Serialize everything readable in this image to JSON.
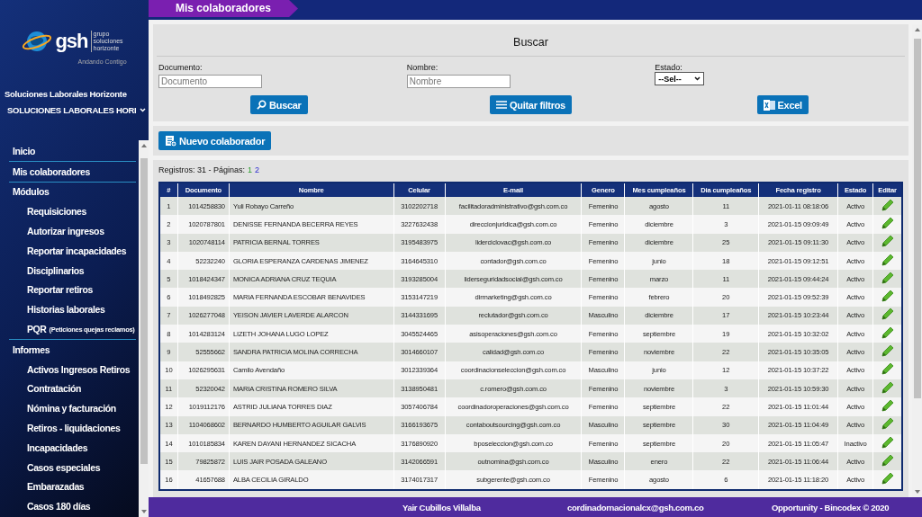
{
  "logo": {
    "name": "gsh",
    "tagline": "grupo soluciones horizonte",
    "motto": "Andando Contigo"
  },
  "company": {
    "title": "Soluciones Laborales Horizonte",
    "selector": "SOLUCIONES LABORALES HORI"
  },
  "menu": [
    {
      "label": "Inicio"
    },
    {
      "label": "Mis colaboradores"
    },
    {
      "label": "Módulos",
      "children": [
        {
          "label": "Requisiciones"
        },
        {
          "label": "Autorizar ingresos"
        },
        {
          "label": "Reportar incapacidades"
        },
        {
          "label": "Disciplinarios"
        },
        {
          "label": "Reportar retiros"
        },
        {
          "label": "Historias laborales"
        },
        {
          "label": "PQR",
          "note": "(Peticiones quejas reclamos)"
        }
      ]
    },
    {
      "label": "Informes",
      "children": [
        {
          "label": "Activos Ingresos Retiros"
        },
        {
          "label": "Contratación"
        },
        {
          "label": "Nómina y facturación"
        },
        {
          "label": "Retiros - liquidaciones"
        },
        {
          "label": "Incapacidades"
        },
        {
          "label": "Casos especiales"
        },
        {
          "label": "Embarazadas"
        },
        {
          "label": "Casos 180 días"
        }
      ]
    }
  ],
  "page_tab": "Mis colaboradores",
  "search": {
    "title": "Buscar",
    "fields": [
      {
        "label": "Documento:",
        "placeholder": "Documento",
        "kind": "text"
      },
      {
        "label": "Nombre:",
        "placeholder": "Nombre",
        "kind": "text"
      },
      {
        "label": "Estado:",
        "value": "--Sel--",
        "kind": "select"
      }
    ],
    "buttons": [
      {
        "label": "Buscar",
        "kind": "search"
      },
      {
        "label": "Quitar filtros",
        "kind": "clear"
      },
      {
        "label": "Excel",
        "kind": "export"
      }
    ]
  },
  "new_button": "Nuevo colaborador",
  "summary": "Registros: 31 - Páginas:",
  "pages": [
    {
      "label": "1",
      "selected": true
    },
    {
      "label": "2",
      "selected": false
    }
  ],
  "table": {
    "columns": [
      "#",
      "Documento",
      "Nombre",
      "Celular",
      "E-mail",
      "Genero",
      "Mes cumpleaños",
      "Dia cumpleaños",
      "Fecha registro",
      "Estado",
      "Editar"
    ],
    "rows": [
      [
        "1",
        "1014258830",
        "Yuli Robayo Carreño",
        "3102202718",
        "facilitadoradministrativo@gsh.com.co",
        "Femenino",
        "agosto",
        "11",
        "2021-01-11 08:18:06",
        "Activo"
      ],
      [
        "2",
        "1020787801",
        "DENISSE FERNANDA BECERRA REYES",
        "3227632438",
        "direccionjuridica@gsh.com.co",
        "Femenino",
        "diciembre",
        "3",
        "2021-01-15 09:09:49",
        "Activo"
      ],
      [
        "3",
        "1020748114",
        "PATRICIA BERNAL TORRES",
        "3195483975",
        "liderciclovac@gsh.com.co",
        "Femenino",
        "diciembre",
        "25",
        "2021-01-15 09:11:30",
        "Activo"
      ],
      [
        "4",
        "52232240",
        "GLORIA ESPERANZA CARDENAS JIMENEZ",
        "3164645310",
        "contador@gsh.com.co",
        "Femenino",
        "junio",
        "18",
        "2021-01-15 09:12:51",
        "Activo"
      ],
      [
        "5",
        "1018424347",
        "MONICA ADRIANA CRUZ TEQUIA",
        "3193285004",
        "liderseguridadsocial@gsh.com.co",
        "Femenino",
        "marzo",
        "11",
        "2021-01-15 09:44:24",
        "Activo"
      ],
      [
        "6",
        "1018492825",
        "MARIA FERNANDA ESCOBAR BENAVIDES",
        "3153147219",
        "dirmarketing@gsh.com.co",
        "Femenino",
        "febrero",
        "20",
        "2021-01-15 09:52:39",
        "Activo"
      ],
      [
        "7",
        "1026277048",
        "YEISON JAVIER LAVERDE ALARCON",
        "3144331695",
        "reclutador@gsh.com.co",
        "Masculino",
        "diciembre",
        "17",
        "2021-01-15 10:23:44",
        "Activo"
      ],
      [
        "8",
        "1014283124",
        "LIZETH JOHANA LUGO LOPEZ",
        "3045524465",
        "asisoperaciones@gsh.com.co",
        "Femenino",
        "septiembre",
        "19",
        "2021-01-15 10:32:02",
        "Activo"
      ],
      [
        "9",
        "52555662",
        "SANDRA PATRICIA MOLINA CORRECHA",
        "3014660107",
        "calidad@gsh.com.co",
        "Femenino",
        "noviembre",
        "22",
        "2021-01-15 10:35:05",
        "Activo"
      ],
      [
        "10",
        "1026295631",
        "Camilo Avendaño",
        "3012339364",
        "coordinacionseleccion@gsh.com.co",
        "Masculino",
        "junio",
        "12",
        "2021-01-15 10:37:22",
        "Activo"
      ],
      [
        "11",
        "52320042",
        "MARIA CRISTINA ROMERO SILVA",
        "3138950481",
        "c.romero@gsh.com.co",
        "Femenino",
        "noviembre",
        "3",
        "2021-01-15 10:59:30",
        "Activo"
      ],
      [
        "12",
        "1019112176",
        "ASTRID JULIANA TORRES DIAZ",
        "3057406784",
        "coordinadoroperaciones@gsh.com.co",
        "Femenino",
        "septiembre",
        "22",
        "2021-01-15 11:01:44",
        "Activo"
      ],
      [
        "13",
        "1104068602",
        "BERNARDO HUMBERTO AGUILAR GALVIS",
        "3166193675",
        "contaboutsourcing@gsh.com.co",
        "Masculino",
        "septiembre",
        "30",
        "2021-01-15 11:04:49",
        "Activo"
      ],
      [
        "14",
        "1010185834",
        "KAREN DAYANI HERNANDEZ SICACHA",
        "3176890920",
        "bposeleccion@gsh.com.co",
        "Femenino",
        "septiembre",
        "20",
        "2021-01-15 11:05:47",
        "Inactivo"
      ],
      [
        "15",
        "79825872",
        "LUIS JAIR POSADA GALEANO",
        "3142066591",
        "outnomina@gsh.com.co",
        "Masculino",
        "enero",
        "22",
        "2021-01-15 11:06:44",
        "Activo"
      ],
      [
        "16",
        "41657688",
        "ALBA CECILIA GIRALDO",
        "3174017317",
        "subgerente@gsh.com.co",
        "Femenino",
        "agosto",
        "6",
        "2021-01-15 11:18:20",
        "Activo"
      ]
    ]
  },
  "footer": [
    "Yair Cubillos Villalba",
    "cordinadornacionalcx@gsh.com.co",
    "Opportunity - Bincodex © 2020"
  ]
}
